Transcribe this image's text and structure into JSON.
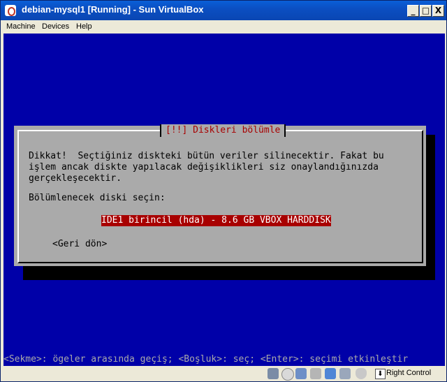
{
  "window": {
    "title": "debian-mysql1 [Running] - Sun VirtualBox",
    "controls": {
      "minimize": "_",
      "maximize": "□",
      "close": "X"
    }
  },
  "menu": {
    "items": [
      "Machine",
      "Devices",
      "Help"
    ]
  },
  "dialog": {
    "title": "[!!] Diskleri bölümle",
    "message": "Dikkat!  Seçtiğiniz diskteki bütün veriler silinecektir. Fakat bu\nişlem ancak diskte yapılacak değişiklikleri siz onaylandığınızda\ngerçekleşecektir.",
    "prompt": "Bölümlenecek diski seçin:",
    "selected_disk": "IDE1 birincil (hda) - 8.6 GB VBOX HARDDISK",
    "back_button": "<Geri dön>"
  },
  "help_line": "<Sekme>: ögeler arasında geçiş; <Boşluk>: seç; <Enter>: seçimi etkinleştir",
  "statusbar": {
    "host_key": "Right Control",
    "icons": [
      "hard-disk-icon",
      "cd-icon",
      "network-icon",
      "usb-icon",
      "shared-folder-icon",
      "display-icon",
      "mouse-icon"
    ]
  },
  "colors": {
    "screen": "#0000a8",
    "dialog": "#aaaaaa",
    "title_red": "#a80000",
    "titlebar": "#0a4fc2"
  }
}
